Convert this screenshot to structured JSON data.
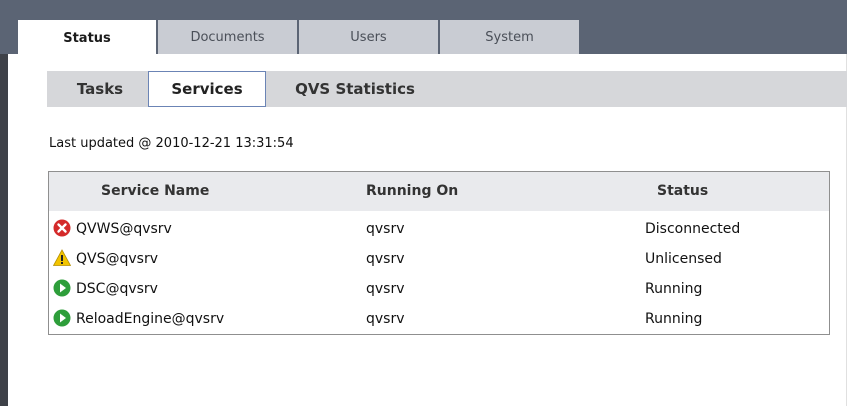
{
  "main_tabs": [
    {
      "label": "Status",
      "active": true
    },
    {
      "label": "Documents",
      "active": false
    },
    {
      "label": "Users",
      "active": false
    },
    {
      "label": "System",
      "active": false
    }
  ],
  "sub_tabs": [
    {
      "label": "Tasks",
      "active": false
    },
    {
      "label": "Services",
      "active": true
    },
    {
      "label": "QVS Statistics",
      "active": false
    }
  ],
  "last_updated": "Last updated @ 2010-12-21 13:31:54",
  "table": {
    "headers": [
      "Service Name",
      "Running On",
      "Status"
    ],
    "rows": [
      {
        "icon": "error-icon",
        "service": "QVWS@qvsrv",
        "running_on": "qvsrv",
        "status": "Disconnected"
      },
      {
        "icon": "warning-icon",
        "service": "QVS@qvsrv",
        "running_on": "qvsrv",
        "status": "Unlicensed"
      },
      {
        "icon": "play-icon",
        "service": "DSC@qvsrv",
        "running_on": "qvsrv",
        "status": "Running"
      },
      {
        "icon": "play-icon",
        "service": "ReloadEngine@qvsrv",
        "running_on": "qvsrv",
        "status": "Running"
      }
    ]
  },
  "colors": {
    "top_band": "#5b6474",
    "error": "#d42a2a",
    "warning": "#f2c400",
    "running": "#2e9e3a"
  }
}
